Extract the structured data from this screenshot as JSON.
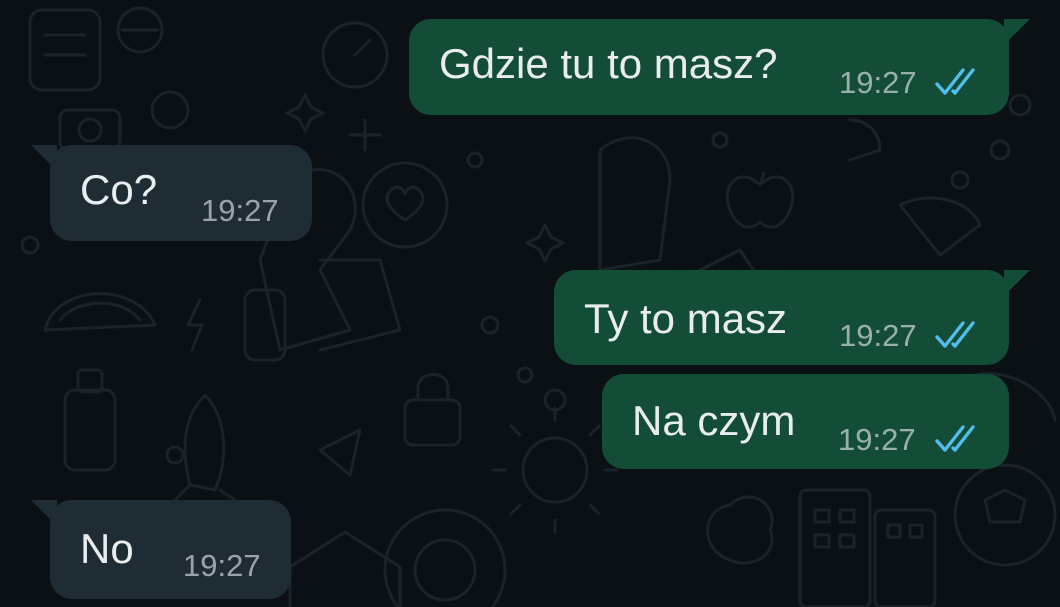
{
  "chat": {
    "messages": [
      {
        "direction": "outgoing",
        "text": "Gdzie tu to masz?",
        "time": "19:27",
        "status_icon": "double-check-read-icon"
      },
      {
        "direction": "incoming",
        "text": "Co?",
        "time": "19:27"
      },
      {
        "direction": "outgoing",
        "text": "Ty to masz",
        "time": "19:27",
        "status_icon": "double-check-read-icon"
      },
      {
        "direction": "outgoing",
        "text": "Na czym",
        "time": "19:27",
        "status_icon": "double-check-read-icon"
      },
      {
        "direction": "incoming",
        "text": "No",
        "time": "19:27"
      }
    ]
  },
  "colors": {
    "background": "#0b1014",
    "incoming_bubble": "#1f2c34",
    "outgoing_bubble": "#134d37",
    "read_tick": "#53bdeb",
    "wallpaper_doodle": "#1a2329"
  }
}
